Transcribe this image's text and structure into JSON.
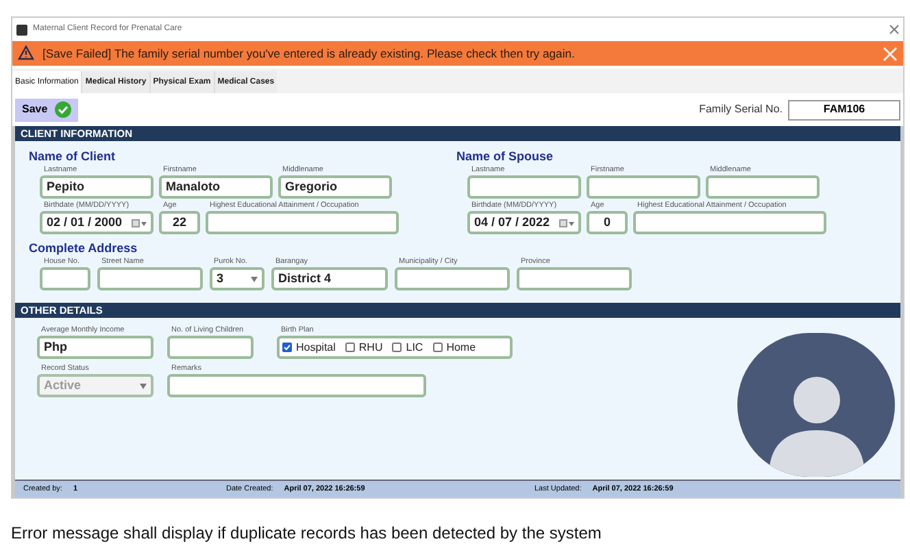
{
  "window": {
    "title": "Maternal Client Record  for Prenatal Care"
  },
  "alert": {
    "message": "[Save Failed] The family serial number you've entered is already existing. Please check then try again."
  },
  "tabs": [
    {
      "label": "Basic Information",
      "selected": true
    },
    {
      "label": "Medical History",
      "selected": false
    },
    {
      "label": "Physical Exam",
      "selected": false
    },
    {
      "label": "Medical Cases",
      "selected": false
    }
  ],
  "save_button": {
    "label": "Save"
  },
  "family_serial": {
    "label": "Family Serial No.",
    "value": "FAM106"
  },
  "client_information": {
    "title": "CLIENT INFORMATION",
    "client": {
      "title": "Name of Client",
      "rows": [
        [
          {
            "label": "Lastname",
            "value": "Pepito",
            "kind": "text"
          },
          {
            "label": "Firstname",
            "value": "Manaloto",
            "kind": "text"
          },
          {
            "label": "Middlename",
            "value": "Gregorio",
            "kind": "text"
          }
        ],
        [
          {
            "label": "Birthdate (MM/DD/YYYY)",
            "value": "02 / 01 / 2000",
            "kind": "date"
          },
          {
            "label": "Age",
            "value": "22",
            "kind": "number"
          },
          {
            "label": "Highest Educational Attainment / Occupation",
            "kind": "text"
          }
        ]
      ]
    },
    "spouse": {
      "title": "Name of Spouse",
      "rows": [
        [
          {
            "label": "Lastname",
            "kind": "text"
          },
          {
            "label": "Firstname",
            "kind": "text"
          },
          {
            "label": "Middlename",
            "kind": "text"
          }
        ],
        [
          {
            "label": "Birthdate (MM/DD/YYYY)",
            "value": "04 / 07 / 2022",
            "kind": "date"
          },
          {
            "label": "Age",
            "value": "0",
            "kind": "number"
          },
          {
            "label": "Highest Educational Attainment / Occupation",
            "kind": "text"
          }
        ]
      ]
    },
    "address": {
      "title": "Complete Address",
      "fields": [
        {
          "label": "House No.",
          "kind": "text"
        },
        {
          "label": "Street Name",
          "kind": "text"
        },
        {
          "label": "Purok No.",
          "value": "3",
          "kind": "select"
        },
        {
          "label": "Barangay",
          "value": "District 4",
          "kind": "text"
        },
        {
          "label": "Municipality / City",
          "kind": "text"
        },
        {
          "label": "Province",
          "kind": "text"
        }
      ]
    }
  },
  "other_details": {
    "title": "OTHER DETAILS",
    "row_1": [
      {
        "label": "Average Monthly Income",
        "value": "Php",
        "kind": "text"
      },
      {
        "label": "No. of Living Children",
        "kind": "text"
      }
    ],
    "birth_plan": {
      "label": "Birth Plan",
      "options": [
        {
          "label": "Hospital",
          "checked": true
        },
        {
          "label": "RHU",
          "checked": false
        },
        {
          "label": "LIC",
          "checked": false
        },
        {
          "label": "Home",
          "checked": false
        }
      ]
    },
    "row_2": [
      {
        "label": "Record Status",
        "value": "Active",
        "kind": "select",
        "disabled": true
      },
      {
        "label": "Remarks",
        "kind": "text"
      }
    ]
  },
  "status_bar": [
    {
      "label": "Created by:",
      "value": "1"
    },
    {
      "label": "Date Created:",
      "value": "April 07, 2022 16:26:59"
    },
    {
      "label": "Last Updated:",
      "value": "April 07, 2022 16:26:59"
    }
  ],
  "caption": "Error message shall display if duplicate records has been detected by the system"
}
